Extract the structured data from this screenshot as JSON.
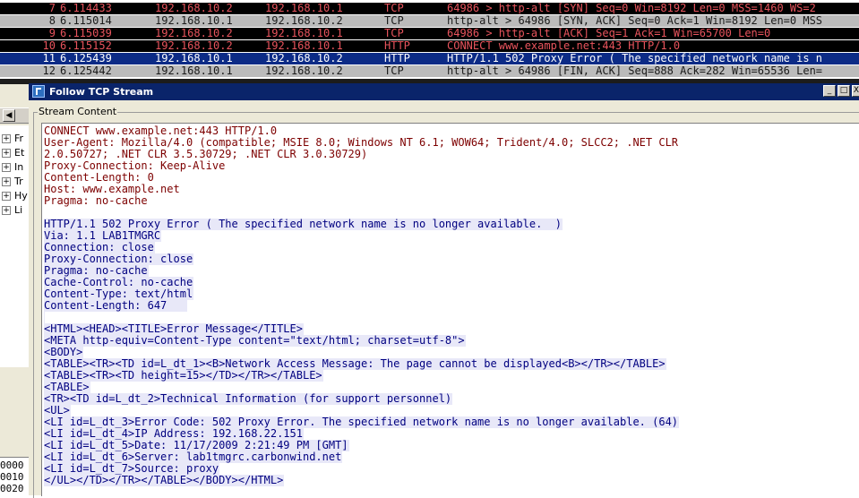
{
  "packets": [
    {
      "no": "7",
      "time": "6.114433",
      "src": "192.168.10.2",
      "dst": "192.168.10.1",
      "proto": "TCP",
      "info": "64986 > http-alt [SYN] Seq=0 Win=8192 Len=0 MSS=1460 WS=2"
    },
    {
      "no": "8",
      "time": "6.115014",
      "src": "192.168.10.1",
      "dst": "192.168.10.2",
      "proto": "TCP",
      "info": "http-alt > 64986 [SYN, ACK] Seq=0 Ack=1 Win=8192 Len=0 MSS"
    },
    {
      "no": "9",
      "time": "6.115039",
      "src": "192.168.10.2",
      "dst": "192.168.10.1",
      "proto": "TCP",
      "info": "64986 > http-alt [ACK] Seq=1 Ack=1 Win=65700 Len=0"
    },
    {
      "no": "10",
      "time": "6.115152",
      "src": "192.168.10.2",
      "dst": "192.168.10.1",
      "proto": "HTTP",
      "info": "CONNECT www.example.net:443 HTTP/1.0"
    },
    {
      "no": "11",
      "time": "6.125439",
      "src": "192.168.10.1",
      "dst": "192.168.10.2",
      "proto": "HTTP",
      "info": "HTTP/1.1 502 Proxy Error ( The specified network name is n"
    },
    {
      "no": "12",
      "time": "6.125442",
      "src": "192.168.10.1",
      "dst": "192.168.10.2",
      "proto": "TCP",
      "info": "http-alt > 64986 [FIN, ACK] Seq=888 Ack=282 Win=65536 Len="
    }
  ],
  "tree_items": [
    "Fr",
    "Et",
    "In",
    "Tr",
    "Hy",
    "Li"
  ],
  "hex_offsets": [
    "0000",
    "0010",
    "0020"
  ],
  "dialog": {
    "title": "Follow TCP Stream",
    "min_glyph": "_",
    "max_glyph": "□",
    "close_glyph": "X",
    "group_label": "Stream Content"
  },
  "colors": {
    "client_text": "#7d0000",
    "server_text": "#000080",
    "server_bg": "#e8e8f8",
    "selected_row": "#0c2b86",
    "title_bar": "#0a246a"
  },
  "stream_lines": [
    {
      "dir": "client",
      "text": "CONNECT www.example.net:443 HTTP/1.0"
    },
    {
      "dir": "client",
      "text": "User-Agent: Mozilla/4.0 (compatible; MSIE 8.0; Windows NT 6.1; WOW64; Trident/4.0; SLCC2; .NET CLR"
    },
    {
      "dir": "client",
      "text": "2.0.50727; .NET CLR 3.5.30729; .NET CLR 3.0.30729)"
    },
    {
      "dir": "client",
      "text": "Proxy-Connection: Keep-Alive"
    },
    {
      "dir": "client",
      "text": "Content-Length: 0"
    },
    {
      "dir": "client",
      "text": "Host: www.example.net"
    },
    {
      "dir": "client",
      "text": "Pragma: no-cache"
    },
    {
      "dir": "client",
      "text": ""
    },
    {
      "dir": "server",
      "text": "HTTP/1.1 502 Proxy Error ( The specified network name is no longer available.  )"
    },
    {
      "dir": "server",
      "text": "Via: 1.1 LAB1TMGRC"
    },
    {
      "dir": "server",
      "text": "Connection: close"
    },
    {
      "dir": "server",
      "text": "Proxy-Connection: close"
    },
    {
      "dir": "server",
      "text": "Pragma: no-cache"
    },
    {
      "dir": "server",
      "text": "Cache-Control: no-cache"
    },
    {
      "dir": "server",
      "text": "Content-Type: text/html"
    },
    {
      "dir": "server",
      "text": "Content-Length: 647   "
    },
    {
      "dir": "server",
      "text": ""
    },
    {
      "dir": "server",
      "text": "<HTML><HEAD><TITLE>Error Message</TITLE>"
    },
    {
      "dir": "server",
      "text": "<META http-equiv=Content-Type content=\"text/html; charset=utf-8\">"
    },
    {
      "dir": "server",
      "text": "<BODY>"
    },
    {
      "dir": "server",
      "text": "<TABLE><TR><TD id=L_dt_1><B>Network Access Message: The page cannot be displayed<B></TR></TABLE>"
    },
    {
      "dir": "server",
      "text": "<TABLE><TR><TD height=15></TD></TR></TABLE>"
    },
    {
      "dir": "server",
      "text": "<TABLE>"
    },
    {
      "dir": "server",
      "text": "<TR><TD id=L_dt_2>Technical Information (for support personnel)"
    },
    {
      "dir": "server",
      "text": "<UL>"
    },
    {
      "dir": "server",
      "text": "<LI id=L_dt_3>Error Code: 502 Proxy Error. The specified network name is no longer available. (64)"
    },
    {
      "dir": "server",
      "text": "<LI id=L_dt_4>IP Address: 192.168.22.151"
    },
    {
      "dir": "server",
      "text": "<LI id=L_dt_5>Date: 11/17/2009 2:21:49 PM [GMT]"
    },
    {
      "dir": "server",
      "text": "<LI id=L_dt_6>Server: lab1tmgrc.carbonwind.net"
    },
    {
      "dir": "server",
      "text": "<LI id=L_dt_7>Source: proxy"
    },
    {
      "dir": "server",
      "text": "</UL></TD></TR></TABLE></BODY></HTML>"
    }
  ]
}
